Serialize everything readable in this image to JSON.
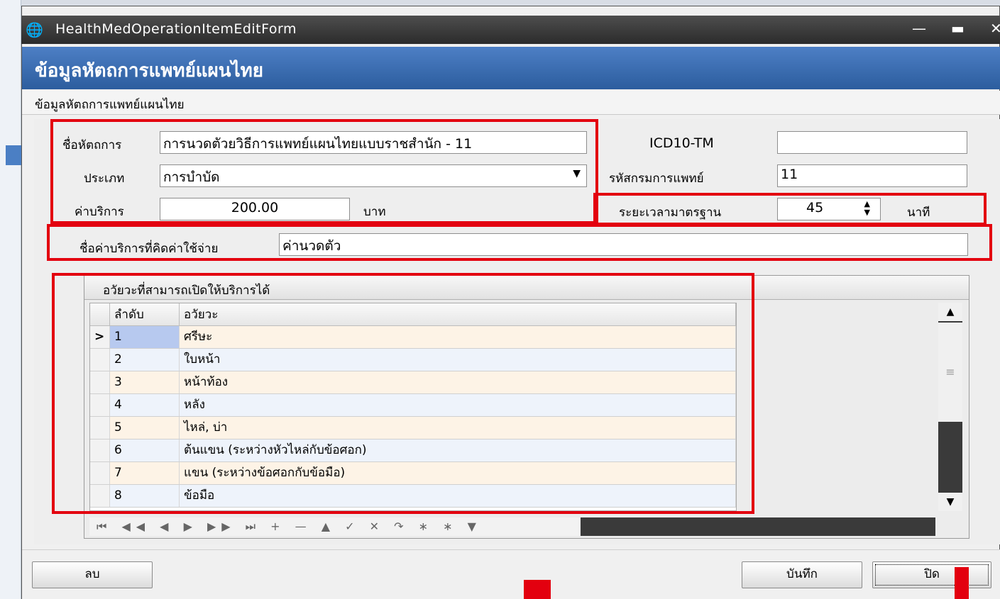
{
  "window": {
    "title": "HealthMedOperationItemEditForm",
    "minimize_icon": "minimize-icon",
    "maximize_icon": "maximize-icon",
    "close_icon": "close-icon"
  },
  "header": {
    "title": "ข้อมูลหัตถการแพทย์แผนไทย"
  },
  "section": {
    "title": "ข้อมูลหัตถการแพทย์แผนไทย"
  },
  "form": {
    "procedure_name_label": "ชื่อหัตถการ",
    "procedure_name_value": "การนวดตัวยวิธีการแพทย์แผนไทยแบบราชสำนัก - 11",
    "type_label": "ประเภท",
    "type_value": "การบำบัด",
    "fee_label": "ค่าบริการ",
    "fee_value": "200.00",
    "fee_unit": "บาท",
    "icd10_label": "ICD10-TM",
    "icd10_value": "",
    "dept_code_label": "รหัสกรมการแพทย์",
    "dept_code_value": "11",
    "std_duration_label": "ระยะเวลามาตรฐาน",
    "std_duration_value": "45",
    "std_duration_unit": "นาที",
    "billing_name_label": "ชื่อค่าบริการที่คิดค่าใช้จ่าย",
    "billing_name_value": "ค่านวดตัว"
  },
  "organs": {
    "group_title": "อวัยวะที่สามารถเปิดให้บริการได้",
    "columns": [
      "ลำดับ",
      "อวัยวะ"
    ],
    "current_row_marker": ">",
    "rows": [
      {
        "no": "1",
        "organ": "ศรีษะ"
      },
      {
        "no": "2",
        "organ": "ใบหน้า"
      },
      {
        "no": "3",
        "organ": "หน้าท้อง"
      },
      {
        "no": "4",
        "organ": "หลัง"
      },
      {
        "no": "5",
        "organ": "ไหล่, บ่า"
      },
      {
        "no": "6",
        "organ": "ต้นแขน (ระหว่างหัวไหล่กับข้อศอก)"
      },
      {
        "no": "7",
        "organ": "แขน (ระหว่างข้อศอกกับข้อมือ)"
      },
      {
        "no": "8",
        "organ": "ข้อมือ"
      }
    ],
    "navigator": "⏮ ◀◀ ◀ ▶ ▶▶ ⏭ + — ▲ ✓ ✕ ↷ ∗ ∗ ▼"
  },
  "buttons": {
    "delete": "ลบ",
    "save": "บันทึก",
    "close": "ปิด"
  },
  "colors": {
    "annotation_red": "#e3000f",
    "header_blue": "#3a6db3",
    "row_alt": "#fdf3e6",
    "selected_cell": "#b7c9ef"
  }
}
